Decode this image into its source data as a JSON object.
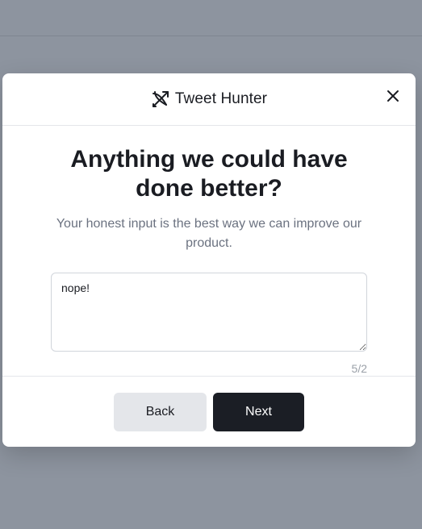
{
  "brand": {
    "name": "Tweet Hunter",
    "logo_icon": "bow-arrow-icon"
  },
  "modal": {
    "title": "Anything we could have done better?",
    "subtitle": "Your honest input is the best way we can improve our product.",
    "feedback": {
      "value": "nope!",
      "char_count": "5/2"
    },
    "buttons": {
      "back_label": "Back",
      "next_label": "Next"
    }
  },
  "colors": {
    "overlay": "#8d949f",
    "primary_button": "#1b1e25",
    "secondary_button": "#e4e6ea",
    "muted_text": "#6b7280"
  }
}
